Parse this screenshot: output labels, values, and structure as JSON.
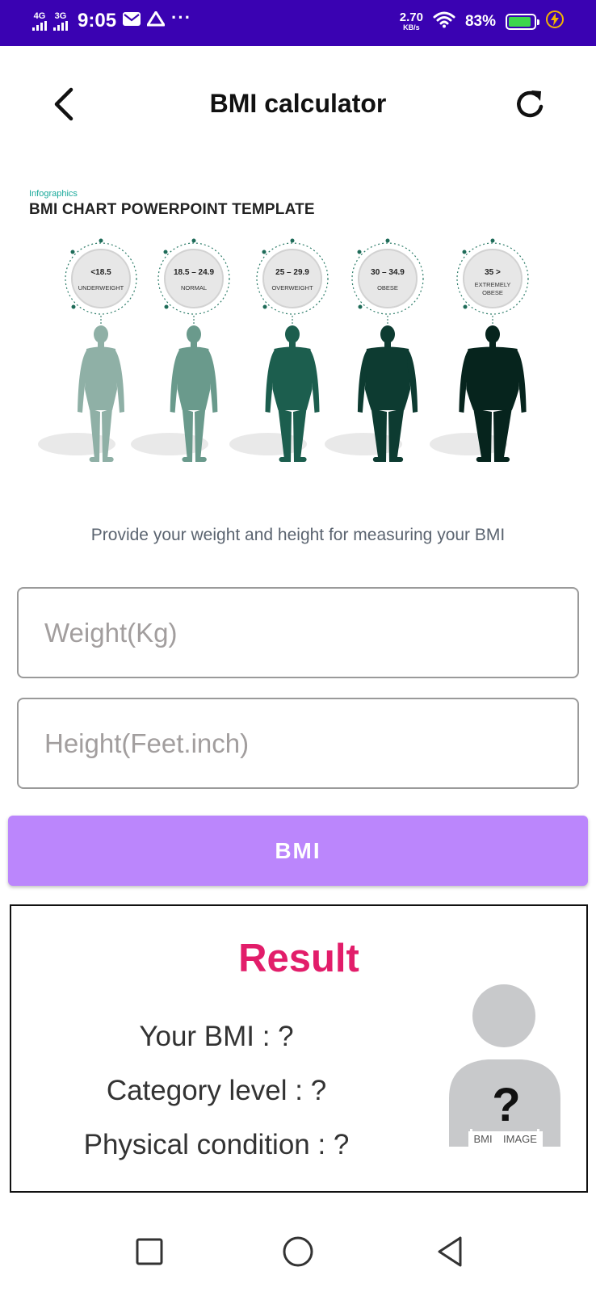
{
  "status_bar": {
    "net1": "4G",
    "net2": "3G",
    "time": "9:05",
    "overflow": "···",
    "speed_value": "2.70",
    "speed_unit": "KB/s",
    "battery_percent": "83%",
    "icons": [
      "signal-icon",
      "mail-icon",
      "drive-icon",
      "wifi-icon",
      "battery-icon",
      "charging-icon"
    ]
  },
  "header": {
    "title": "BMI calculator",
    "back_icon": "back-arrow-icon",
    "refresh_icon": "refresh-icon"
  },
  "infographic": {
    "kicker": "Infographics",
    "title": "BMI CHART POWERPOINT TEMPLATE",
    "categories": [
      {
        "range": "<18.5",
        "label": "UNDERWEIGHT",
        "color": "#8fb0a6"
      },
      {
        "range": "18.5 – 24.9",
        "label": "NORMAL",
        "color": "#6a9a8c"
      },
      {
        "range": "25 – 29.9",
        "label": "OVERWEIGHT",
        "color": "#1c5e4e"
      },
      {
        "range": "30 – 34.9",
        "label": "OBESE",
        "color": "#0d3b31"
      },
      {
        "range": "35 >",
        "label": "EXTREMELY OBESE",
        "color": "#06241d"
      }
    ]
  },
  "instruction": "Provide your weight and height for measuring your BMI",
  "form": {
    "weight_placeholder": "Weight(Kg)",
    "height_placeholder": "Height(Feet.inch)",
    "button_label": "BMI"
  },
  "result": {
    "title": "Result",
    "bmi_line": "Your BMI : ?",
    "category_line": "Category level : ?",
    "condition_line": "Physical condition : ?",
    "avatar_mark": "?",
    "avatar_caption_left": "BMI",
    "avatar_caption_right": "IMAGE"
  },
  "colors": {
    "status_bar": "#3a02b2",
    "button": "#bb86fc",
    "result_title": "#e21d6a",
    "accent_teal": "#19a99a"
  },
  "nav": {
    "icons": [
      "recents-icon",
      "home-icon",
      "nav-back-icon"
    ]
  }
}
